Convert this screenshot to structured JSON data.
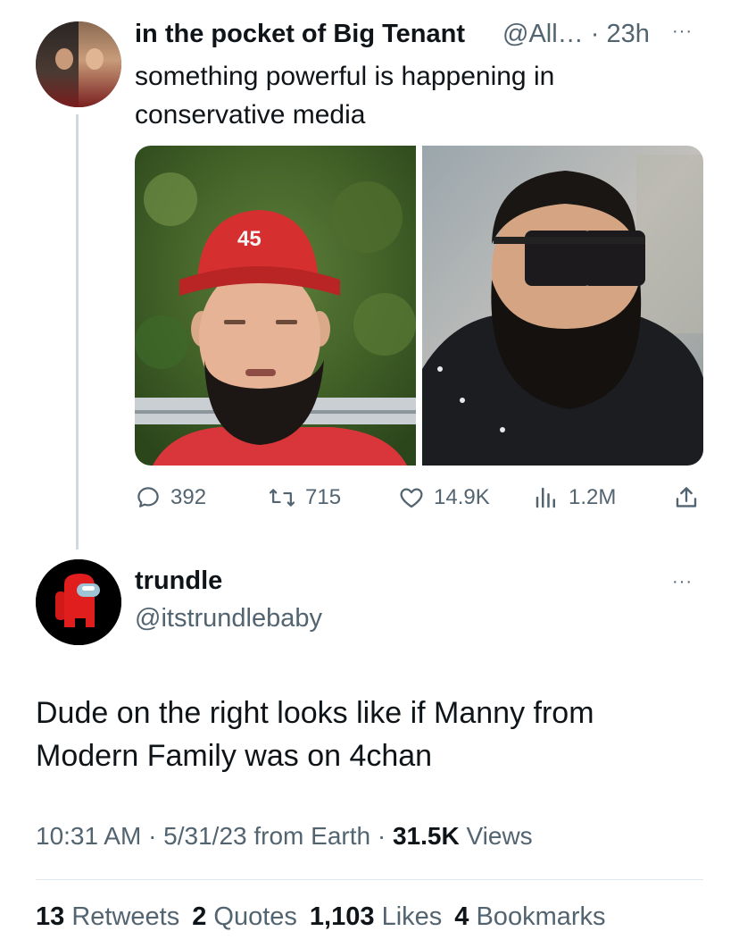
{
  "tweet": {
    "author_name": "in the pocket of Big Tenant",
    "author_handle_time": "@All… · 23h",
    "more": "···",
    "text": "something powerful is happening in conservative media",
    "cap_text": "45",
    "actions": {
      "replies": "392",
      "retweets": "715",
      "likes": "14.9K",
      "views": "1.2M"
    }
  },
  "reply": {
    "author_name": "trundle",
    "author_handle": "@itstrundlebaby",
    "more": "···",
    "text": "Dude on the right looks like if Manny from Modern Family was on 4chan",
    "meta": {
      "time_date": "10:31 AM · 5/31/23 from Earth · ",
      "views_count": "31.5K",
      "views_label": " Views"
    },
    "stats": {
      "retweets_count": "13",
      "retweets_label": "Retweets",
      "quotes_count": "2",
      "quotes_label": "Quotes",
      "likes_count": "1,103",
      "likes_label": "Likes",
      "bookmarks_count": "4",
      "bookmarks_label": "Bookmarks"
    }
  },
  "icons": {
    "reply": "reply-icon",
    "retweet": "retweet-icon",
    "like": "heart-icon",
    "views": "views-icon",
    "share": "share-icon"
  },
  "colors": {
    "text": "#0f1419",
    "muted": "#536471",
    "thread_line": "#cfd9de",
    "amongus_red": "#d1191a"
  }
}
